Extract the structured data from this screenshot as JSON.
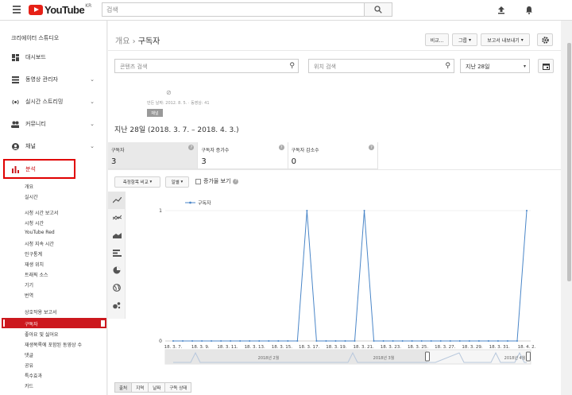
{
  "topbar": {
    "region": "KR",
    "logo_text": "YouTube",
    "search_placeholder": "검색"
  },
  "sidebar": {
    "title": "크리에이터 스튜디오",
    "items": [
      {
        "label": "대시보드",
        "icon": "dashboard-icon"
      },
      {
        "label": "동영상 관리자",
        "icon": "video-manager-icon"
      },
      {
        "label": "실시간 스트리밍",
        "icon": "live-stream-icon"
      },
      {
        "label": "커뮤니티",
        "icon": "community-icon"
      },
      {
        "label": "채널",
        "icon": "channel-icon"
      },
      {
        "label": "분석",
        "icon": "analytics-icon"
      }
    ],
    "analytics_sub": [
      "개요",
      "실시간"
    ],
    "watch_time": [
      "시청 시간 보고서",
      "시청 시간",
      "YouTube Red",
      "시청 지속 시간",
      "인구통계",
      "재생 위치",
      "트래픽 소스",
      "기기",
      "번역"
    ],
    "interaction": [
      "상호작용 보고서",
      "구독자",
      "좋아요 및 싫어요",
      "재생목록에 포함된 동영상 수",
      "댓글",
      "공유",
      "특수효과",
      "카드"
    ]
  },
  "main": {
    "breadcrumb_parent": "개요",
    "breadcrumb_sep": " › ",
    "breadcrumb_current": "구독자",
    "buttons": {
      "compare": "비교...",
      "group": "그룹",
      "export": "보고서 내보내기"
    },
    "content_search_placeholder": "콘텐츠 검색",
    "location_search_placeholder": "위치 검색",
    "period": "지난 28일",
    "channel_meta": "만든 날짜: 2012. 8. 5. · 동영상: 41",
    "channel_tag": "채널",
    "date_range": "지난 28일 (2018. 3. 7. – 2018. 4. 3.)",
    "metrics": [
      {
        "label": "구독자",
        "value": "3"
      },
      {
        "label": "구독자 증가수",
        "value": "3"
      },
      {
        "label": "구독자 감소수",
        "value": "0"
      }
    ],
    "compare_metric": "측정항목 비교",
    "interval": "일별",
    "cumulative": "증가율 보기",
    "bottom_tabs": [
      "출처",
      "지역",
      "날짜",
      "구독 상태"
    ]
  },
  "colors": {
    "accent": "#cc181e",
    "line": "#4a86c8"
  },
  "chart_data": {
    "type": "line",
    "series": [
      {
        "name": "구독자",
        "values": [
          0,
          0,
          0,
          0,
          0,
          0,
          0,
          0,
          0,
          0,
          0,
          0,
          0,
          0,
          1,
          0,
          0,
          0,
          0,
          0,
          1,
          0,
          0,
          0,
          0,
          0,
          0,
          0,
          0,
          0,
          0,
          0,
          0,
          0,
          0,
          0,
          0,
          1
        ]
      }
    ],
    "x": [
      "18. 3. 7.",
      "",
      "18. 3. 9.",
      "",
      "18. 3. 11.",
      "",
      "18. 3. 13.",
      "",
      "18. 3. 15.",
      "",
      "18. 3. 17.",
      "",
      "18. 3. 19.",
      "",
      "18. 3. 21.",
      "",
      "18. 3. 23.",
      "",
      "18. 3. 25.",
      "",
      "18. 3. 27.",
      "",
      "18. 3. 29.",
      "",
      "18. 3. 31.",
      "",
      "18. 4. 2."
    ],
    "tick_labels": [
      "18. 3. 7.",
      "18. 3. 9.",
      "18. 3. 11.",
      "18. 3. 13.",
      "18. 3. 15.",
      "18. 3. 17.",
      "18. 3. 19.",
      "18. 3. 21.",
      "18. 3. 23.",
      "18. 3. 25.",
      "18. 3. 27.",
      "18. 3. 29.",
      "18. 3. 31.",
      "18. 4. 2."
    ],
    "y_ticks": [
      "0",
      "1"
    ],
    "ylim": [
      0,
      1
    ],
    "legend": "top-left",
    "navigator_labels": [
      "2018년 2월",
      "2018년 3월",
      "2018년 4월"
    ]
  }
}
